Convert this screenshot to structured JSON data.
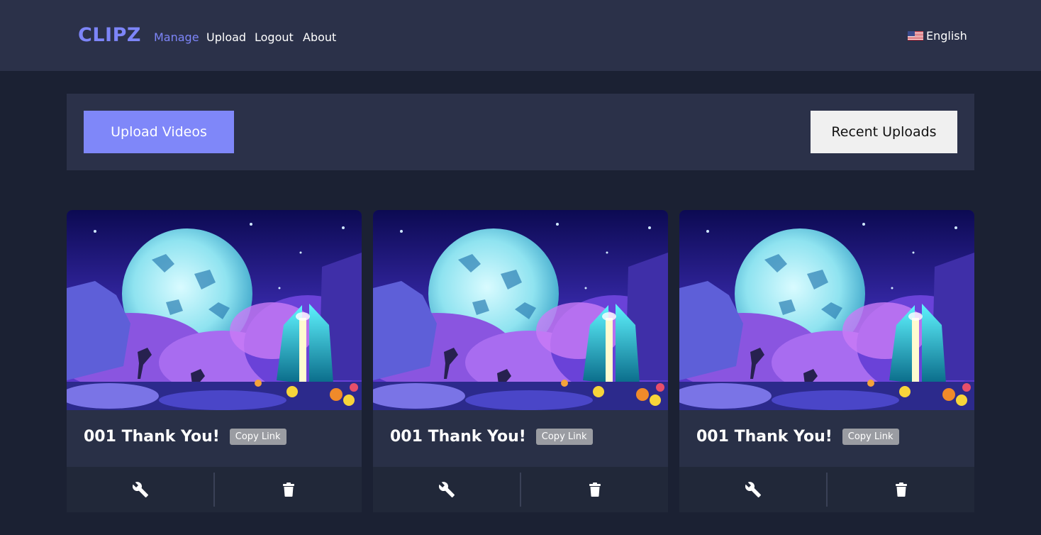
{
  "brand": "CLIPZ",
  "nav": {
    "manage": "Manage",
    "upload": "Upload",
    "logout": "Logout",
    "about": "About",
    "language": "English"
  },
  "actions": {
    "upload_videos": "Upload Videos",
    "recent_uploads": "Recent Uploads"
  },
  "clips": [
    {
      "title": "001 Thank You!",
      "copy_label": "Copy Link",
      "edit_icon": "wrench-icon",
      "delete_icon": "trash-icon"
    },
    {
      "title": "001 Thank You!",
      "copy_label": "Copy Link",
      "edit_icon": "wrench-icon",
      "delete_icon": "trash-icon"
    },
    {
      "title": "001 Thank You!",
      "copy_label": "Copy Link",
      "edit_icon": "wrench-icon",
      "delete_icon": "trash-icon"
    }
  ],
  "colors": {
    "accent": "#7d85f8",
    "navbar": "#2b3149",
    "background": "#1b2133",
    "card_footer": "#212839"
  }
}
